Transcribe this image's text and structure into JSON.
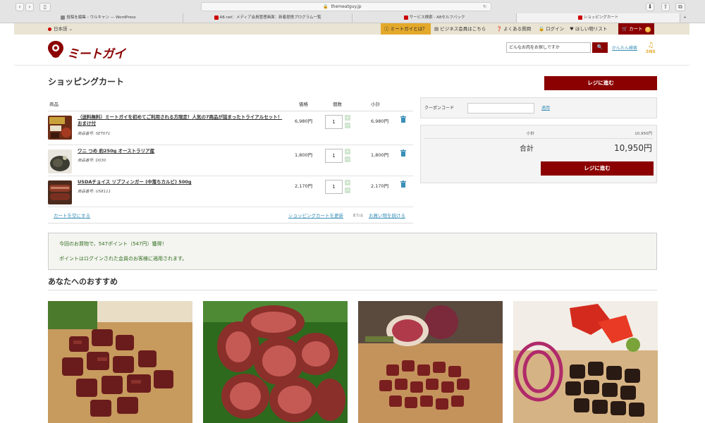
{
  "browser": {
    "url": "themeatguy.jp",
    "tabs": [
      {
        "label": "投稿を編集 ‹ ウルキャン — WordPress",
        "active": false
      },
      {
        "label": "A8.net：メディア会員管理画面：新着提携プログラム一覧",
        "active": false
      },
      {
        "label": "サービス検索 - A8セルフバック",
        "active": false
      },
      {
        "label": "ショッピングカート",
        "active": true
      }
    ]
  },
  "topbar": {
    "language": "日本語",
    "about": "ミートガイとは？",
    "business": "ビジネス会員はこちら",
    "faq": "よくある質問",
    "login": "ログイン",
    "wishlist": "ほしい物リスト",
    "cart": "カート",
    "cart_count": "0"
  },
  "header": {
    "logo_text": "ミートガイ",
    "search_placeholder": "どんなお肉をお探しですか",
    "easy_search": "かんたん検索",
    "sns": "SNS"
  },
  "page": {
    "title": "ショッピングカート",
    "checkout_label": "レジに進む"
  },
  "cart": {
    "col_product": "商品",
    "col_price": "価格",
    "col_qty": "個数",
    "col_subtotal": "小計",
    "items": [
      {
        "name": "（送料無料）ミートガイを初めてご利用される方限定！人気の7商品が詰まったトライアルセット！おまけ付",
        "sku": "商品番号: SET071",
        "price": "6,980円",
        "qty": "1",
        "subtotal": "6,980円"
      },
      {
        "name": "ワニ つめ 約250g オーストラリア産",
        "sku": "商品番号: D030",
        "price": "1,800円",
        "qty": "1",
        "subtotal": "1,800円"
      },
      {
        "name": "USDAチョイス リブフィンガー (中落ちカルビ) 500g",
        "sku": "商品番号: US8111",
        "price": "2,170円",
        "qty": "1",
        "subtotal": "2,170円"
      }
    ],
    "empty_cart": "カートを空にする",
    "update_cart": "ショッピングカートを更新",
    "or": "または",
    "continue_shopping": "お買い物を続ける"
  },
  "coupon": {
    "label": "クーポンコード",
    "apply": "適用"
  },
  "summary": {
    "subtotal_label": "小計",
    "subtotal_value": "10,950円",
    "total_label": "合計",
    "total_value": "10,950円",
    "checkout_label": "レジに進む"
  },
  "points": {
    "line1": "今回のお買物で、547ポイント（547円）獲得！",
    "line2": "ポイントはログインされた会員のお客様に適用されます。"
  },
  "recommend": {
    "title": "あなたへのおすすめ"
  },
  "colors": {
    "brand_red": "#8b0000",
    "accent_gold": "#e4a92b",
    "link_blue": "#3a8fb7",
    "points_green": "#2f6e1e"
  }
}
